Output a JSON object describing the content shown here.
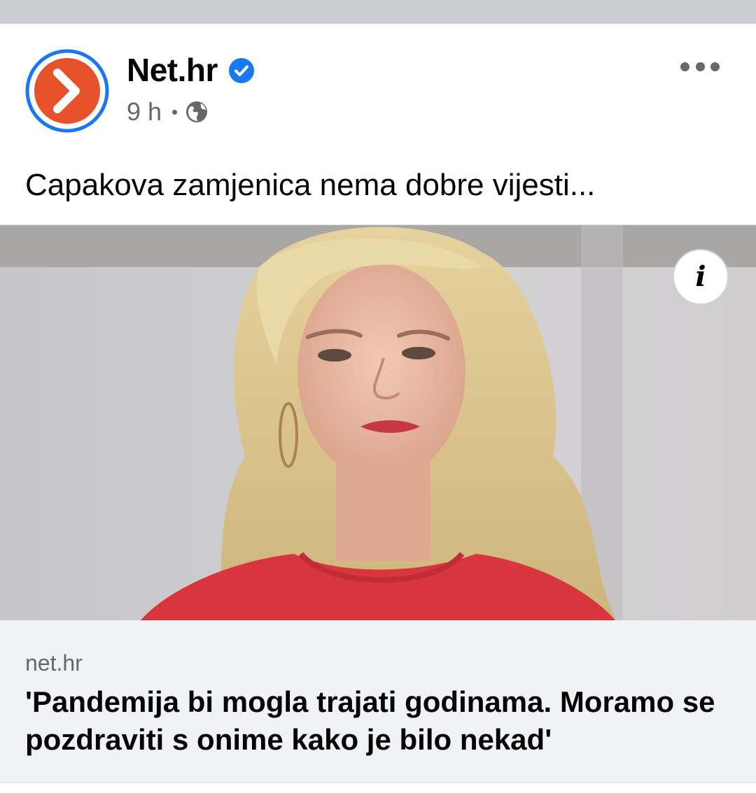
{
  "post": {
    "page_name": "Net.hr",
    "time": "9 h",
    "separator": "•",
    "caption": "Capakova zamjenica nema dobre vijesti...",
    "avatar_icon": "chevron-right-logo",
    "verified_icon": "verified-badge-icon",
    "audience_icon": "globe-icon",
    "menu_icon": "more-horizontal-icon",
    "image_info_icon": "info-icon",
    "colors": {
      "brand": "#e8522b",
      "ring": "#1877f2",
      "verified": "#1877f2"
    }
  },
  "link": {
    "domain": "net.hr",
    "headline": "'Pandemija bi mogla trajati godinama. Moramo se pozdraviti s onime kako je bilo nekad'"
  }
}
